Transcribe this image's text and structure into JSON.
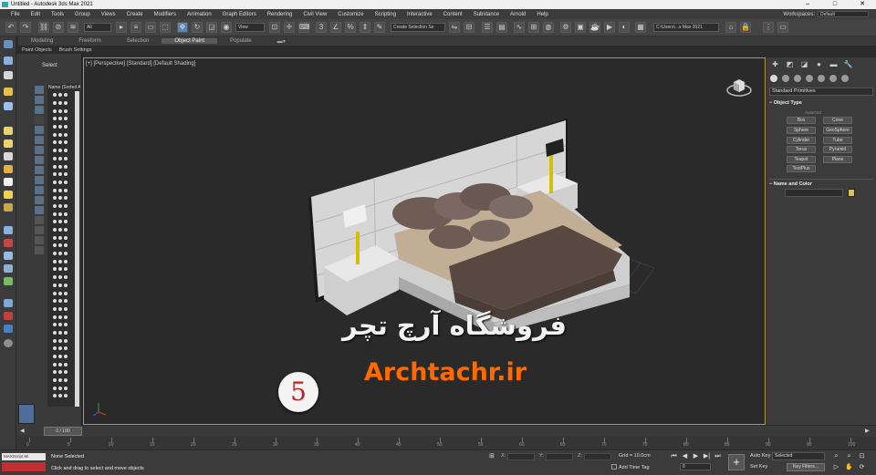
{
  "window": {
    "title": "Untitled - Autodesk 3ds Max 2021",
    "controls": [
      "–",
      "□",
      "✕"
    ]
  },
  "menu": [
    "File",
    "Edit",
    "Tools",
    "Group",
    "Views",
    "Create",
    "Modifiers",
    "Animation",
    "Graph Editors",
    "Rendering",
    "Civil View",
    "Customize",
    "Scripting",
    "Interactive",
    "Content",
    "Substance",
    "Arnold",
    "Help"
  ],
  "workspaces": {
    "label": "Workspaces:",
    "value": "Default"
  },
  "toolbar": {
    "filter_value": "All",
    "refcoord_value": "View",
    "named_selection_placeholder": "Create Selection Se",
    "project_path": "C:\\Users\\...s Max 2021"
  },
  "ribbon": {
    "tabs": [
      "Modeling",
      "Freeform",
      "Selection",
      "Object Paint",
      "Populate"
    ],
    "active": "Object Paint",
    "sub": [
      "Paint Objects",
      "Brush Settings"
    ]
  },
  "scene_explorer": {
    "title": "Select",
    "column_header": "Name (Sorted A"
  },
  "viewport": {
    "label": "[+] [Perspective] [Standard] [Default Shading]"
  },
  "command_panel": {
    "category": "Standard Primitives",
    "object_type_title": "Object Type",
    "autogrid": "AutoGrid",
    "buttons": [
      "Box",
      "Cone",
      "Sphere",
      "GeoSphere",
      "Cylinder",
      "Tube",
      "Torus",
      "Pyramid",
      "Teapot",
      "Plane",
      "TextPlus"
    ],
    "name_color_title": "Name and Color",
    "swatch_color": "#d8c060"
  },
  "time_slider": {
    "value": "0 / 100"
  },
  "timeline": {
    "ticks": [
      "0",
      "5",
      "10",
      "15",
      "20",
      "25",
      "30",
      "35",
      "40",
      "45",
      "50",
      "55",
      "60",
      "65",
      "70",
      "75",
      "80",
      "85",
      "90",
      "95",
      "100"
    ]
  },
  "status": {
    "maxscript": "MAXScript Mi",
    "selection": "None Selected",
    "hint": "Click and drag to select and move objects",
    "x_label": "X:",
    "y_label": "Y:",
    "z_label": "Z:",
    "grid": "Grid = 10.0cm",
    "add_time_tag": "Add Time Tag",
    "frame": "0",
    "auto_key": "Auto Key",
    "set_key": "Set Key",
    "selected_dropdown": "Selected",
    "key_filters": "Key Filters..."
  },
  "overlay": {
    "badge_number": "5",
    "persian_text": "فروشگاه آرچ تچر",
    "site": "Archtachr.ir"
  }
}
